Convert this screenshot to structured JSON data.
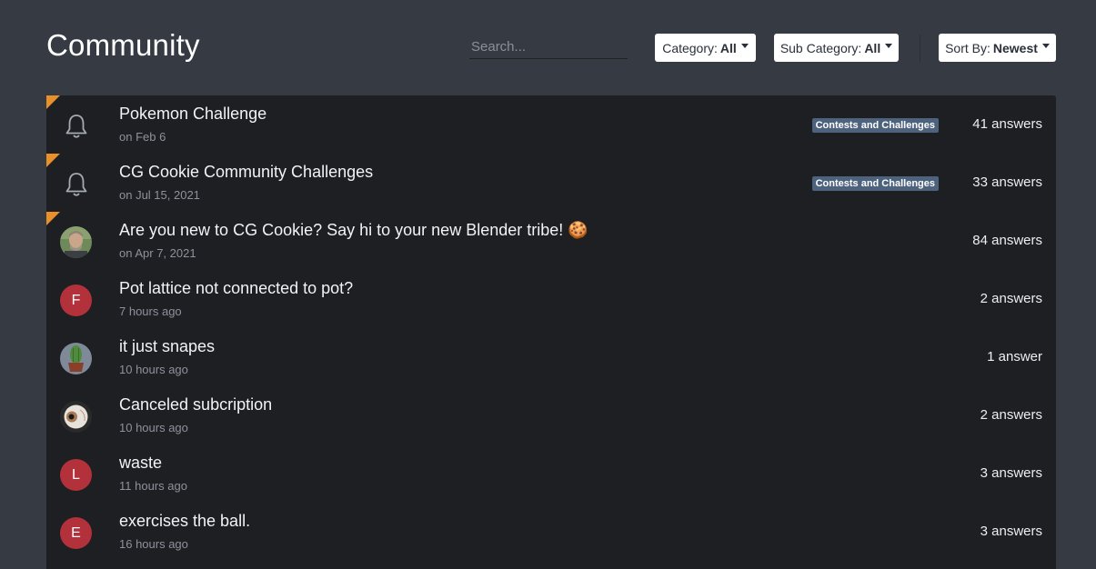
{
  "page": {
    "title": "Community"
  },
  "search": {
    "placeholder": "Search..."
  },
  "filters": {
    "category": {
      "label": "Category:",
      "value": "All"
    },
    "subcategory": {
      "label": "Sub Category:",
      "value": "All"
    },
    "sort": {
      "label": "Sort By:",
      "value": "Newest"
    }
  },
  "colors": {
    "background": "#353a43",
    "list_background": "#1d1f23",
    "pin_accent": "#e8902a",
    "tag_background": "#4d627d",
    "letter_avatar": "#b3313a"
  },
  "threads": [
    {
      "title": "Pokemon Challenge",
      "time": "on Feb 6",
      "tag": "Contests and Challenges",
      "answers": "41 answers",
      "pinned": true,
      "avatar": "bell-icon"
    },
    {
      "title": "CG Cookie Community Challenges",
      "time": "on Jul 15, 2021",
      "tag": "Contests and Challenges",
      "answers": "33 answers",
      "pinned": true,
      "avatar": "bell-icon"
    },
    {
      "title": "Are you new to CG Cookie? Say hi to your new Blender tribe! 🍪",
      "time": "on Apr 7, 2021",
      "tag": "",
      "answers": "84 answers",
      "pinned": true,
      "avatar": "user-photo-avatar"
    },
    {
      "title": "Pot lattice not connected to pot?",
      "time": "7 hours ago",
      "tag": "",
      "answers": "2 answers",
      "pinned": false,
      "avatar": "F"
    },
    {
      "title": "it just snapes",
      "time": "10 hours ago",
      "tag": "",
      "answers": "1 answer",
      "pinned": false,
      "avatar": "cactus-avatar"
    },
    {
      "title": "Canceled subcription",
      "time": "10 hours ago",
      "tag": "",
      "answers": "2 answers",
      "pinned": false,
      "avatar": "eyeball-avatar"
    },
    {
      "title": "waste",
      "time": "11 hours ago",
      "tag": "",
      "answers": "3 answers",
      "pinned": false,
      "avatar": "L"
    },
    {
      "title": "exercises the ball.",
      "time": "16 hours ago",
      "tag": "",
      "answers": "3 answers",
      "pinned": false,
      "avatar": "E"
    }
  ]
}
